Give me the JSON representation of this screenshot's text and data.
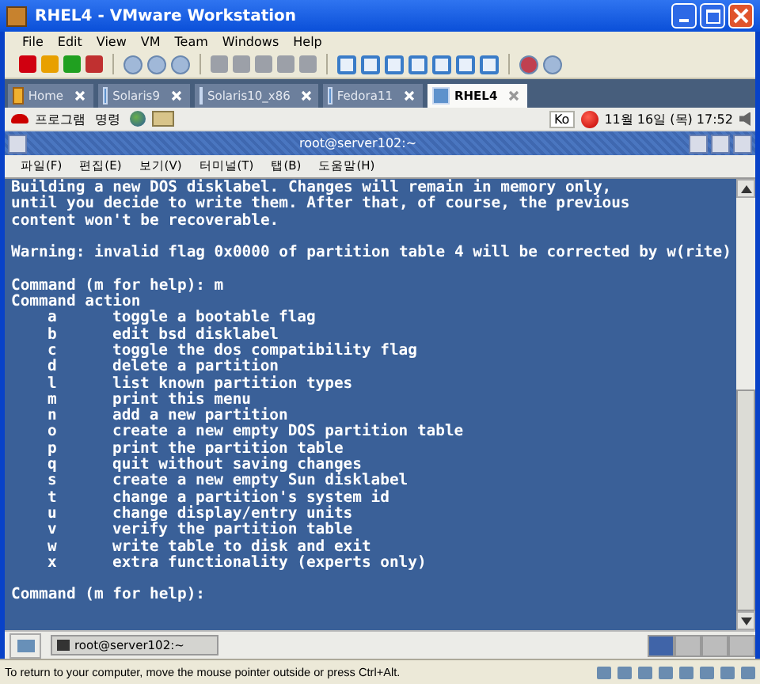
{
  "window": {
    "title": "RHEL4 - VMware Workstation"
  },
  "menu": [
    "File",
    "Edit",
    "View",
    "VM",
    "Team",
    "Windows",
    "Help"
  ],
  "tabs": [
    {
      "label": "Home",
      "selected": false
    },
    {
      "label": "Solaris9",
      "selected": false
    },
    {
      "label": "Solaris10_x86",
      "selected": false
    },
    {
      "label": "Fedora11",
      "selected": false
    },
    {
      "label": "RHEL4",
      "selected": true
    }
  ],
  "guest_panel": {
    "menus": [
      "프로그램",
      "명령"
    ],
    "input_method": "Ko",
    "clock": "11월 16일 (목) 17:52"
  },
  "terminal": {
    "title": "root@server102:~",
    "menu": [
      "파일(F)",
      "편집(E)",
      "보기(V)",
      "터미널(T)",
      "탭(B)",
      "도움말(H)"
    ],
    "intro": [
      "Building a new DOS disklabel. Changes will remain in memory only,",
      "until you decide to write them. After that, of course, the previous",
      "content won't be recoverable."
    ],
    "warning": "Warning: invalid flag 0x0000 of partition table 4 will be corrected by w(rite)",
    "prompt_1": "Command (m for help): m",
    "heading": "Command action",
    "actions": [
      {
        "key": "a",
        "desc": "toggle a bootable flag"
      },
      {
        "key": "b",
        "desc": "edit bsd disklabel"
      },
      {
        "key": "c",
        "desc": "toggle the dos compatibility flag"
      },
      {
        "key": "d",
        "desc": "delete a partition"
      },
      {
        "key": "l",
        "desc": "list known partition types"
      },
      {
        "key": "m",
        "desc": "print this menu"
      },
      {
        "key": "n",
        "desc": "add a new partition"
      },
      {
        "key": "o",
        "desc": "create a new empty DOS partition table"
      },
      {
        "key": "p",
        "desc": "print the partition table"
      },
      {
        "key": "q",
        "desc": "quit without saving changes"
      },
      {
        "key": "s",
        "desc": "create a new empty Sun disklabel"
      },
      {
        "key": "t",
        "desc": "change a partition's system id"
      },
      {
        "key": "u",
        "desc": "change display/entry units"
      },
      {
        "key": "v",
        "desc": "verify the partition table"
      },
      {
        "key": "w",
        "desc": "write table to disk and exit"
      },
      {
        "key": "x",
        "desc": "extra functionality (experts only)"
      }
    ],
    "prompt_2": "Command (m for help):"
  },
  "taskbar": {
    "item": "root@server102:~"
  },
  "status_bar": "To return to your computer, move the mouse pointer outside or press Ctrl+Alt."
}
